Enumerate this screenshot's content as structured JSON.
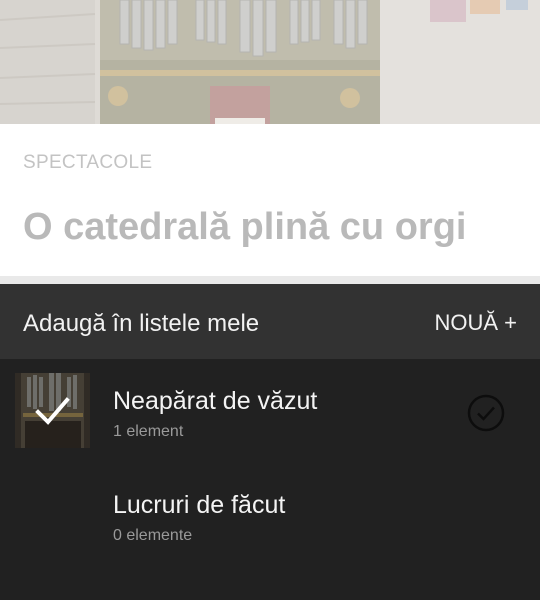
{
  "header": {
    "category": "SPECTACOLE",
    "title": "O catedrală plină cu orgi"
  },
  "sheet": {
    "title": "Adaugă în listele mele",
    "new_label": "NOUĂ +",
    "items": [
      {
        "name": "Neapărat de văzut",
        "count": "1 element",
        "selected": true,
        "thumbnail_icon": "organ-photo"
      },
      {
        "name": "Lucruri de făcut",
        "count": "0 elemente",
        "selected": false
      }
    ]
  },
  "colors": {
    "sheet_header_bg": "#323232",
    "sheet_body_bg": "#212121",
    "title_text": "#b9b9b9",
    "category_text": "#c3c3c3",
    "item_text": "#f4f4f4",
    "secondary_text": "#9a9a9a"
  }
}
